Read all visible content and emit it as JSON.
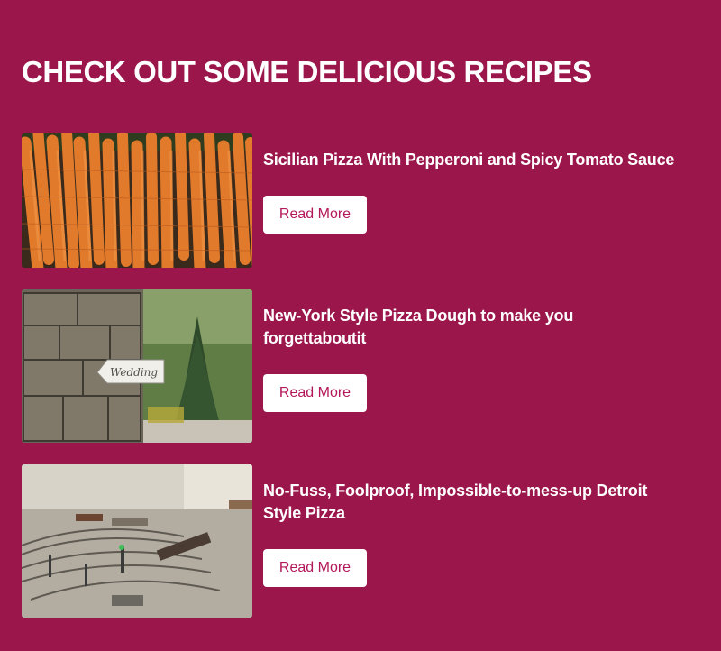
{
  "section": {
    "title": "CHECK OUT SOME DELICIOUS RECIPES"
  },
  "recipes": [
    {
      "title": "Sicilian Pizza With Pepperoni and Spicy Tomato Sauce",
      "button_label": "Read More",
      "image_subject": "bundled carrots"
    },
    {
      "title": "New-York Style Pizza Dough to make you forgettaboutit",
      "button_label": "Read More",
      "image_subject": "stone pillar with wedding sign",
      "image_text": "Wedding"
    },
    {
      "title": "No-Fuss, Foolproof, Impossible-to-mess-up Detroit Style Pizza",
      "button_label": "Read More",
      "image_subject": "model railroad layout"
    }
  ],
  "colors": {
    "background": "#9b164b",
    "button_background": "#ffffff",
    "button_text": "#b3185a",
    "heading_text": "#ffffff"
  }
}
